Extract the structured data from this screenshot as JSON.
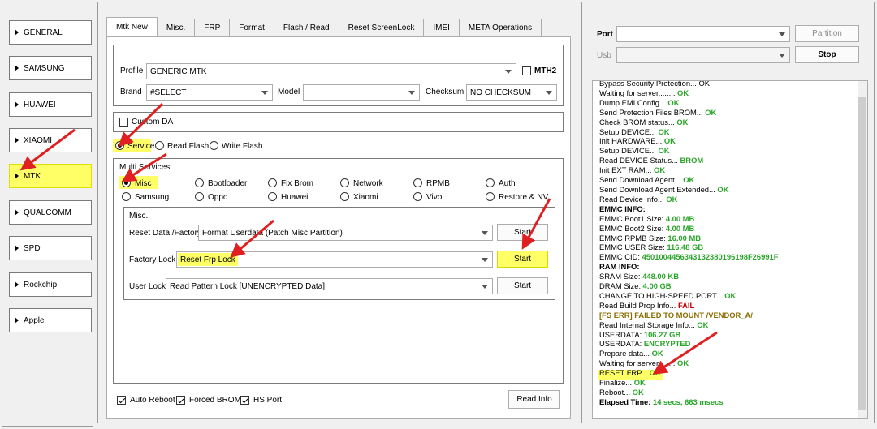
{
  "sidebar": {
    "items": [
      {
        "label": "GENERAL",
        "active": false
      },
      {
        "label": "SAMSUNG",
        "active": false
      },
      {
        "label": "HUAWEI",
        "active": false
      },
      {
        "label": "XIAOMI",
        "active": false
      },
      {
        "label": "MTK",
        "active": true
      },
      {
        "label": "QUALCOMM",
        "active": false
      },
      {
        "label": "SPD",
        "active": false
      },
      {
        "label": "Rockchip",
        "active": false
      },
      {
        "label": "Apple",
        "active": false
      }
    ]
  },
  "tabs": [
    "Mtk New",
    "Misc.",
    "FRP",
    "Format",
    "Flash / Read",
    "Reset ScreenLock",
    "IMEI",
    "META Operations"
  ],
  "settings": {
    "profile_label": "Profile",
    "profile_value": "GENERIC MTK",
    "mth2_label": "MTH2",
    "brand_label": "Brand",
    "brand_value": "#SELECT",
    "model_label": "Model",
    "model_value": "",
    "checksum_label": "Checksum",
    "checksum_value": "NO CHECKSUM"
  },
  "custom_da_label": "Custom DA",
  "modes": {
    "service": "Service",
    "read_flash": "Read Flash",
    "write_flash": "Write Flash"
  },
  "multi": {
    "title": "Multi Services",
    "row1": [
      "Misc",
      "Bootloader",
      "Fix Brom",
      "Network",
      "RPMB",
      "Auth"
    ],
    "row2": [
      "Samsung",
      "Oppo",
      "Huawei",
      "Xiaomi",
      "Vivo",
      "Restore & NV"
    ]
  },
  "misc": {
    "title": "Misc.",
    "reset_label": "Reset Data /Factory",
    "reset_value": "Format Userdata (Patch Misc Partition)",
    "factory_label": "Factory Lock",
    "factory_value": "Reset Frp Lock",
    "user_label": "User Lock",
    "user_value": "Read Pattern Lock [UNENCRYPTED Data]",
    "start": "Start"
  },
  "bottom": {
    "auto_reboot": "Auto Reboot",
    "forced_brom": "Forced BROM",
    "hs_port": "HS Port",
    "read_info": "Read Info"
  },
  "right": {
    "port_label": "Port",
    "usb_label": "Usb",
    "partition_btn": "Partition",
    "stop_btn": "Stop"
  },
  "log": [
    [
      [
        "Bypass Security Protection... OK",
        ""
      ]
    ],
    [
      [
        "Waiting for server........ ",
        ""
      ],
      [
        "OK",
        "ok"
      ]
    ],
    [
      [
        "Dump EMI Config... ",
        ""
      ],
      [
        "OK",
        "ok"
      ]
    ],
    [
      [
        "Send Protection Files BROM... ",
        ""
      ],
      [
        "OK",
        "ok"
      ]
    ],
    [
      [
        "Check BROM status... ",
        ""
      ],
      [
        "OK",
        "ok"
      ]
    ],
    [
      [
        "Setup DEVICE... ",
        ""
      ],
      [
        "OK",
        "ok"
      ]
    ],
    [
      [
        "Init HARDWARE... ",
        ""
      ],
      [
        "OK",
        "ok"
      ]
    ],
    [
      [
        "Setup DEVICE... ",
        ""
      ],
      [
        "OK",
        "ok"
      ]
    ],
    [
      [
        "Read DEVICE Status... ",
        ""
      ],
      [
        "BROM",
        "ok"
      ]
    ],
    [
      [
        "Init EXT RAM... ",
        ""
      ],
      [
        "OK",
        "ok"
      ]
    ],
    [
      [
        "Send Download Agent... ",
        ""
      ],
      [
        "OK",
        "ok"
      ]
    ],
    [
      [
        "Send Download Agent Extended... ",
        ""
      ],
      [
        "OK",
        "ok"
      ]
    ],
    [
      [
        "Read Device Info... ",
        ""
      ],
      [
        "OK",
        "ok"
      ]
    ],
    [
      [
        "EMMC INFO:",
        "b"
      ]
    ],
    [
      [
        "EMMC Boot1 Size: ",
        ""
      ],
      [
        "4.00 MB",
        "ok"
      ]
    ],
    [
      [
        "EMMC Boot2 Size: ",
        ""
      ],
      [
        "4.00 MB",
        "ok"
      ]
    ],
    [
      [
        "EMMC RPMB Size: ",
        ""
      ],
      [
        "16.00 MB",
        "ok"
      ]
    ],
    [
      [
        "EMMC USER Size: ",
        ""
      ],
      [
        "116.48 GB",
        "ok"
      ]
    ],
    [
      [
        "EMMC CID: ",
        ""
      ],
      [
        "4501004456343132380196198F26991F",
        "ok"
      ]
    ],
    [
      [
        "RAM INFO:",
        "b"
      ]
    ],
    [
      [
        "SRAM Size: ",
        ""
      ],
      [
        "448.00 KB",
        "ok"
      ]
    ],
    [
      [
        "DRAM Size: ",
        ""
      ],
      [
        "4.00 GB",
        "ok"
      ]
    ],
    [
      [
        "CHANGE TO HIGH-SPEED PORT... ",
        ""
      ],
      [
        "OK",
        "ok"
      ]
    ],
    [
      [
        "Read Build Prop Info... ",
        ""
      ],
      [
        "FAIL",
        "fail"
      ]
    ],
    [
      [
        "  [FS ERR] FAILED TO MOUNT /VENDOR_A/",
        "warn"
      ]
    ],
    [
      [
        "Read Internal Storage Info... ",
        ""
      ],
      [
        "OK",
        "ok"
      ]
    ],
    [
      [
        "USERDATA: ",
        ""
      ],
      [
        "106.27 GB",
        "ok"
      ]
    ],
    [
      [
        "USERDATA: ",
        ""
      ],
      [
        "ENCRYPTED",
        "ok"
      ]
    ],
    [
      [
        "Prepare data... ",
        ""
      ],
      [
        "OK",
        "ok"
      ]
    ],
    [
      [
        "Waiting for server........ ",
        ""
      ],
      [
        "OK",
        "ok"
      ]
    ],
    [
      [
        "RESET FRP... ",
        ""
      ],
      [
        "OK",
        "ok"
      ]
    ],
    [
      [
        "Finalize... ",
        ""
      ],
      [
        "OK",
        "ok"
      ]
    ],
    [
      [
        "Reboot... ",
        ""
      ],
      [
        "OK",
        "ok"
      ]
    ],
    [
      [
        "Elapsed Time: ",
        "b"
      ],
      [
        "14 secs, 663 msecs",
        "ok"
      ]
    ]
  ]
}
